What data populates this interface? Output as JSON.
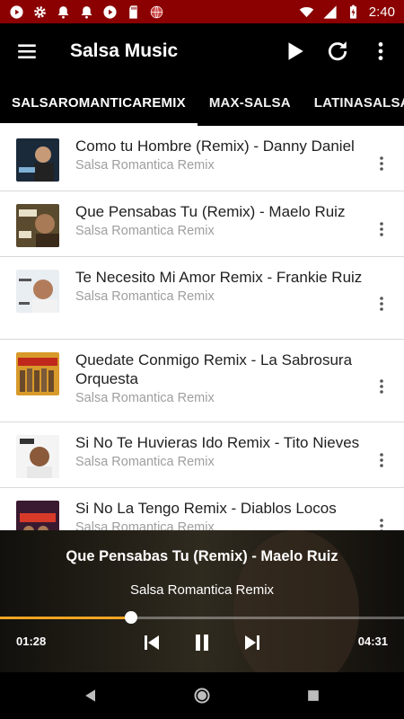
{
  "status_bar": {
    "time": "2:40",
    "left_icons": [
      "play-circle-icon",
      "gear-icon",
      "bell-icon",
      "bell-icon",
      "play-circle-icon",
      "sd-card-icon",
      "globe-icon"
    ],
    "right_icons": [
      "wifi-icon",
      "signal-icon",
      "battery-icon"
    ]
  },
  "toolbar": {
    "title": "Salsa Music",
    "icons": [
      "menu-icon",
      "play-icon",
      "refresh-icon",
      "more-vert-icon"
    ]
  },
  "tabs": [
    {
      "label": "SALSAROMANTICAREMIX",
      "active": true
    },
    {
      "label": "MAX-SALSA",
      "active": false
    },
    {
      "label": "LATINASALSA",
      "active": false
    }
  ],
  "songs": [
    {
      "title": "Como tu Hombre (Remix) - Danny Daniel",
      "subtitle": "Salsa Romantica Remix"
    },
    {
      "title": "Que Pensabas Tu (Remix) - Maelo Ruiz",
      "subtitle": "Salsa Romantica Remix"
    },
    {
      "title": "Te Necesito Mi Amor Remix - Frankie Ruiz",
      "subtitle": "Salsa Romantica Remix"
    },
    {
      "title": "Quedate Conmigo Remix - La Sabrosura Orquesta",
      "subtitle": "Salsa Romantica Remix"
    },
    {
      "title": "Si No Te Huvieras Ido Remix - Tito Nieves",
      "subtitle": "Salsa Romantica Remix"
    },
    {
      "title": "Si No La Tengo Remix - Diablos Locos",
      "subtitle": "Salsa Romantica Remix"
    }
  ],
  "player": {
    "title": "Que Pensabas Tu (Remix) - Maelo Ruiz",
    "subtitle": "Salsa Romantica Remix",
    "elapsed": "01:28",
    "total": "04:31",
    "progress": 0.325,
    "accent_color": "#f5a623",
    "controls": [
      "skip-previous-icon",
      "pause-icon",
      "skip-next-icon"
    ]
  },
  "nav_bar": {
    "icons": [
      "back-icon",
      "home-icon",
      "recents-icon"
    ]
  },
  "colors": {
    "status_bar": "#8b0000",
    "toolbar": "#000000",
    "subtitle_text": "#9e9e9e"
  }
}
